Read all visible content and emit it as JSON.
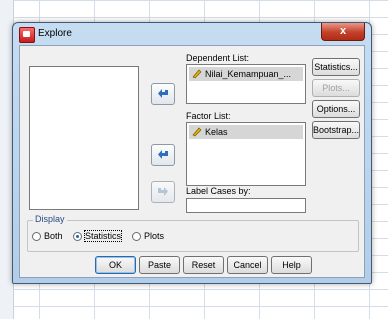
{
  "dialog": {
    "title": "Explore",
    "close_label": "x"
  },
  "dependent": {
    "label": "Dependent List:",
    "items": [
      "Nilai_Kemampuan_..."
    ]
  },
  "factor": {
    "label": "Factor List:",
    "items": [
      "Kelas"
    ]
  },
  "label_cases": {
    "label": "Label Cases by:",
    "value": ""
  },
  "side_buttons": {
    "statistics": "Statistics...",
    "plots": "Plots...",
    "options": "Options...",
    "bootstrap": "Bootstrap..."
  },
  "display": {
    "title": "Display",
    "options": [
      "Both",
      "Statistics",
      "Plots"
    ],
    "selected": "Statistics"
  },
  "bottom_buttons": {
    "ok": "OK",
    "paste": "Paste",
    "reset": "Reset",
    "cancel": "Cancel",
    "help": "Help"
  },
  "colors": {
    "arrow": "#2e6fbd",
    "ruler": "#e0b400"
  }
}
